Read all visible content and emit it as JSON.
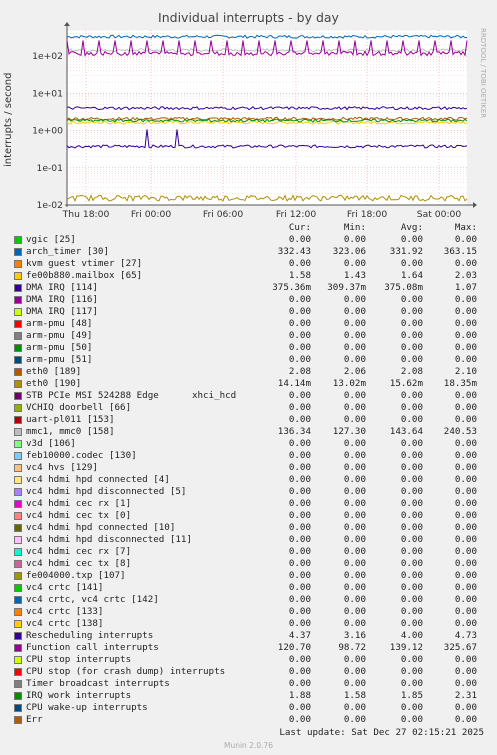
{
  "chart_data": {
    "type": "line",
    "title": "Individual interrupts - by day",
    "ylabel": "interrupts / second",
    "yscale": "log",
    "ylim": [
      0.01,
      500
    ],
    "yticks": [
      {
        "v": 100,
        "label": "1e+02"
      },
      {
        "v": 10,
        "label": "1e+01"
      },
      {
        "v": 1,
        "label": "1e+00"
      },
      {
        "v": 0.1,
        "label": "1e-01"
      },
      {
        "v": 0.01,
        "label": "1e-02"
      }
    ],
    "xticks": [
      "Thu 18:00",
      "Fri 00:00",
      "Fri 06:00",
      "Fri 12:00",
      "Fri 18:00",
      "Sat 00:00"
    ],
    "grid": true,
    "columns": [
      "Cur:",
      "Min:",
      "Avg:",
      "Max:"
    ],
    "series": [
      {
        "name": "vgic [25]",
        "color": "#00cc00",
        "values": [
          "0.00",
          "0.00",
          "0.00",
          "0.00"
        ]
      },
      {
        "name": "arch_timer [30]",
        "color": "#0066b3",
        "values": [
          "332.43",
          "323.06",
          "331.92",
          "363.15"
        ]
      },
      {
        "name": "kvm guest vtimer [27]",
        "color": "#ff8000",
        "values": [
          "0.00",
          "0.00",
          "0.00",
          "0.00"
        ]
      },
      {
        "name": "fe00b880.mailbox [65]",
        "color": "#ffcc00",
        "values": [
          "1.58",
          "1.43",
          "1.64",
          "2.03"
        ]
      },
      {
        "name": "DMA IRQ [114]",
        "color": "#330099",
        "values": [
          "375.36m",
          "309.37m",
          "375.08m",
          "1.07"
        ]
      },
      {
        "name": "DMA IRQ [116]",
        "color": "#990099",
        "values": [
          "0.00",
          "0.00",
          "0.00",
          "0.00"
        ]
      },
      {
        "name": "DMA IRQ [117]",
        "color": "#ccff00",
        "values": [
          "0.00",
          "0.00",
          "0.00",
          "0.00"
        ]
      },
      {
        "name": "arm-pmu [48]",
        "color": "#ff0000",
        "values": [
          "0.00",
          "0.00",
          "0.00",
          "0.00"
        ]
      },
      {
        "name": "arm-pmu [49]",
        "color": "#808080",
        "values": [
          "0.00",
          "0.00",
          "0.00",
          "0.00"
        ]
      },
      {
        "name": "arm-pmu [50]",
        "color": "#008f00",
        "values": [
          "0.00",
          "0.00",
          "0.00",
          "0.00"
        ]
      },
      {
        "name": "arm-pmu [51]",
        "color": "#00487d",
        "values": [
          "0.00",
          "0.00",
          "0.00",
          "0.00"
        ]
      },
      {
        "name": "eth0 [189]",
        "color": "#b35a00",
        "values": [
          "2.08",
          "2.06",
          "2.08",
          "2.10"
        ]
      },
      {
        "name": "eth0 [190]",
        "color": "#b38f00",
        "values": [
          "14.14m",
          "13.02m",
          "15.62m",
          "18.35m"
        ]
      },
      {
        "name": "STB PCIe MSI 524288 Edge      xhci_hcd",
        "color": "#6b006b",
        "values": [
          "0.00",
          "0.00",
          "0.00",
          "0.00"
        ]
      },
      {
        "name": "VCHIQ doorbell [66]",
        "color": "#8fb300",
        "values": [
          "0.00",
          "0.00",
          "0.00",
          "0.00"
        ]
      },
      {
        "name": "uart-pl011 [153]",
        "color": "#b30000",
        "values": [
          "0.00",
          "0.00",
          "0.00",
          "0.00"
        ]
      },
      {
        "name": "mmc1, mmc0 [158]",
        "color": "#bebebe",
        "values": [
          "136.34",
          "127.30",
          "143.64",
          "240.53"
        ]
      },
      {
        "name": "v3d [106]",
        "color": "#80ff80",
        "values": [
          "0.00",
          "0.00",
          "0.00",
          "0.00"
        ]
      },
      {
        "name": "feb10000.codec [130]",
        "color": "#80c9ff",
        "values": [
          "0.00",
          "0.00",
          "0.00",
          "0.00"
        ]
      },
      {
        "name": "vc4 hvs [129]",
        "color": "#ffc080",
        "values": [
          "0.00",
          "0.00",
          "0.00",
          "0.00"
        ]
      },
      {
        "name": "vc4 hdmi hpd connected [4]",
        "color": "#ffe680",
        "values": [
          "0.00",
          "0.00",
          "0.00",
          "0.00"
        ]
      },
      {
        "name": "vc4 hdmi hpd disconnected [5]",
        "color": "#aa80ff",
        "values": [
          "0.00",
          "0.00",
          "0.00",
          "0.00"
        ]
      },
      {
        "name": "vc4 hdmi cec rx [1]",
        "color": "#ee00cc",
        "values": [
          "0.00",
          "0.00",
          "0.00",
          "0.00"
        ]
      },
      {
        "name": "vc4 hdmi cec tx [0]",
        "color": "#ff8080",
        "values": [
          "0.00",
          "0.00",
          "0.00",
          "0.00"
        ]
      },
      {
        "name": "vc4 hdmi hpd connected [10]",
        "color": "#666600",
        "values": [
          "0.00",
          "0.00",
          "0.00",
          "0.00"
        ]
      },
      {
        "name": "vc4 hdmi hpd disconnected [11]",
        "color": "#ffbfff",
        "values": [
          "0.00",
          "0.00",
          "0.00",
          "0.00"
        ]
      },
      {
        "name": "vc4 hdmi cec rx [7]",
        "color": "#00ffcc",
        "values": [
          "0.00",
          "0.00",
          "0.00",
          "0.00"
        ]
      },
      {
        "name": "vc4 hdmi cec tx [8]",
        "color": "#cc6699",
        "values": [
          "0.00",
          "0.00",
          "0.00",
          "0.00"
        ]
      },
      {
        "name": "fe004000.txp [107]",
        "color": "#999900",
        "values": [
          "0.00",
          "0.00",
          "0.00",
          "0.00"
        ]
      },
      {
        "name": "vc4 crtc [141]",
        "color": "#00cc00",
        "values": [
          "0.00",
          "0.00",
          "0.00",
          "0.00"
        ]
      },
      {
        "name": "vc4 crtc, vc4 crtc [142]",
        "color": "#0066b3",
        "values": [
          "0.00",
          "0.00",
          "0.00",
          "0.00"
        ]
      },
      {
        "name": "vc4 crtc [133]",
        "color": "#ff8000",
        "values": [
          "0.00",
          "0.00",
          "0.00",
          "0.00"
        ]
      },
      {
        "name": "vc4 crtc [138]",
        "color": "#ffcc00",
        "values": [
          "0.00",
          "0.00",
          "0.00",
          "0.00"
        ]
      },
      {
        "name": "Rescheduling interrupts",
        "color": "#330099",
        "values": [
          "4.37",
          "3.16",
          "4.00",
          "4.73"
        ]
      },
      {
        "name": "Function call interrupts",
        "color": "#990099",
        "values": [
          "120.70",
          "98.72",
          "139.12",
          "325.67"
        ]
      },
      {
        "name": "CPU stop interrupts",
        "color": "#ccff00",
        "values": [
          "0.00",
          "0.00",
          "0.00",
          "0.00"
        ]
      },
      {
        "name": "CPU stop (for crash dump) interrupts",
        "color": "#ff0000",
        "values": [
          "0.00",
          "0.00",
          "0.00",
          "0.00"
        ]
      },
      {
        "name": "Timer broadcast interrupts",
        "color": "#808080",
        "values": [
          "0.00",
          "0.00",
          "0.00",
          "0.00"
        ]
      },
      {
        "name": "IRQ work interrupts",
        "color": "#008f00",
        "values": [
          "1.88",
          "1.58",
          "1.85",
          "2.31"
        ]
      },
      {
        "name": "CPU wake-up interrupts",
        "color": "#00487d",
        "values": [
          "0.00",
          "0.00",
          "0.00",
          "0.00"
        ]
      },
      {
        "name": "Err",
        "color": "#b35a00",
        "values": [
          "0.00",
          "0.00",
          "0.00",
          "0.00"
        ]
      }
    ]
  },
  "side_text": "RRDTOOL / TOBI OETIKER",
  "footer": {
    "last_update": "Last update: Sat Dec 27 02:15:21 2025",
    "munin": "Munin 2.0.76"
  }
}
